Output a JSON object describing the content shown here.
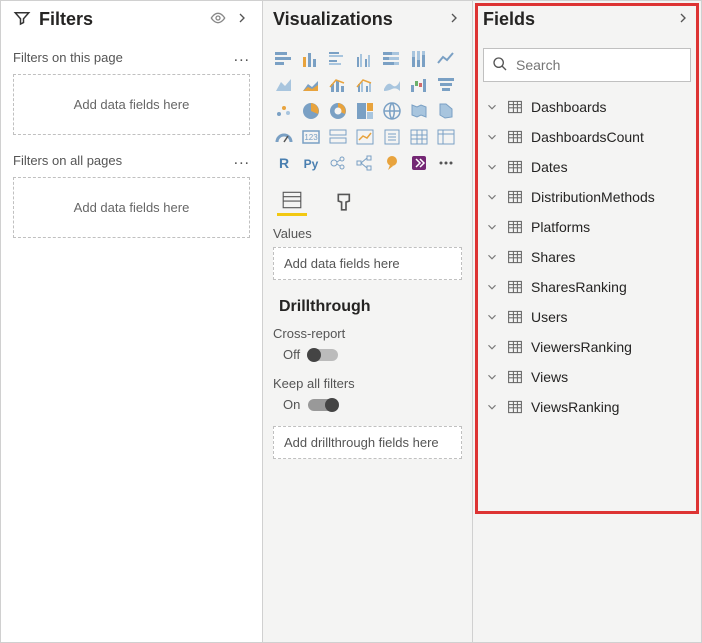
{
  "filters": {
    "title": "Filters",
    "sections": [
      {
        "label": "Filters on this page",
        "placeholder": "Add data fields here"
      },
      {
        "label": "Filters on all pages",
        "placeholder": "Add data fields here"
      }
    ]
  },
  "visualizations": {
    "title": "Visualizations",
    "values_label": "Values",
    "values_placeholder": "Add data fields here",
    "drillthrough_title": "Drillthrough",
    "cross_report_label": "Cross-report",
    "cross_report_state": "Off",
    "keep_filters_label": "Keep all filters",
    "keep_filters_state": "On",
    "drill_placeholder": "Add drillthrough fields here"
  },
  "fields": {
    "title": "Fields",
    "search_placeholder": "Search",
    "tables": [
      "Dashboards",
      "DashboardsCount",
      "Dates",
      "DistributionMethods",
      "Platforms",
      "Shares",
      "SharesRanking",
      "Users",
      "ViewersRanking",
      "Views",
      "ViewsRanking"
    ]
  }
}
